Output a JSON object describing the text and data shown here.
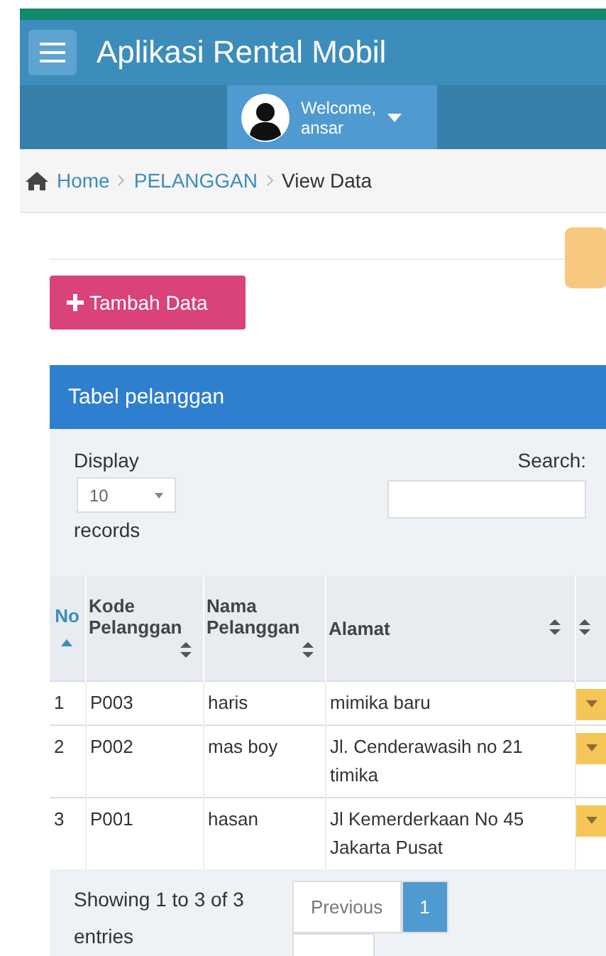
{
  "header": {
    "title": "Aplikasi Rental Mobil"
  },
  "user_panel": {
    "greeting": "Welcome,",
    "name": "ansar"
  },
  "breadcrumb": [
    {
      "label": "Home",
      "kind": "home"
    },
    {
      "label": "PELANGGAN",
      "kind": "link"
    },
    {
      "label": "View Data",
      "kind": "current"
    }
  ],
  "add_button": {
    "label": "Tambah Data"
  },
  "box": {
    "title": "Tabel pelanggan"
  },
  "length_menu": {
    "before": "Display",
    "value": "10",
    "after": "records"
  },
  "search": {
    "label": "Search:"
  },
  "table": {
    "columns": [
      {
        "label": "No",
        "sorted": true
      },
      {
        "label": "Kode Pelanggan",
        "sorted": false
      },
      {
        "label": "Nama Pelanggan",
        "sorted": false
      },
      {
        "label": "Alamat",
        "sorted": false
      },
      {
        "sorted": false
      }
    ],
    "rows": [
      {
        "cells": [
          "1",
          "P003",
          "haris",
          "mimika baru"
        ]
      },
      {
        "cells": [
          "2",
          "P002",
          "mas boy",
          "Jl. Cenderawasih no 21 timika"
        ]
      },
      {
        "cells": [
          "3",
          "P001",
          "hasan",
          "Jl Kemerderkaan No 45 Jakarta Pusat"
        ]
      }
    ]
  },
  "info": "Showing 1 to 3 of 3 entries",
  "pagination": {
    "previous": "Previous",
    "pages": [
      {
        "label": "1",
        "selected": true
      }
    ]
  }
}
